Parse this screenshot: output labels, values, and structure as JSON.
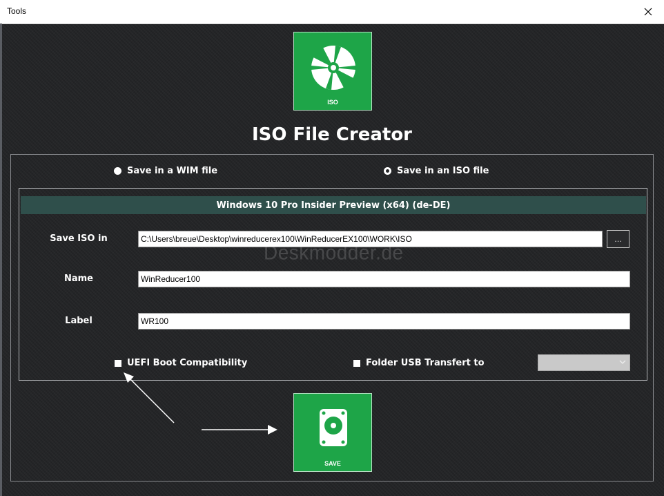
{
  "window": {
    "title": "Tools"
  },
  "iso_tile": {
    "label": "ISO",
    "icon": "disc-icon"
  },
  "heading": "ISO File Creator",
  "options": {
    "wim_label": "Save in a WIM file",
    "iso_label": "Save in an ISO file",
    "selected": "iso"
  },
  "edition": "Windows 10 Pro Insider Preview (x64) (de-DE)",
  "fields": {
    "save_iso_in": {
      "label": "Save ISO in",
      "value": "C:\\Users\\breue\\Desktop\\winreducerex100\\WinReducerEX100\\WORK\\ISO"
    },
    "name": {
      "label": "Name",
      "value": "WinReducer100"
    },
    "iso_label": {
      "label": "Label",
      "value": "WR100"
    }
  },
  "browse_label": "...",
  "checkboxes": {
    "uefi_label": "UEFI Boot Compatibility",
    "usb_label": "Folder USB Transfert to"
  },
  "save_tile": {
    "label": "SAVE",
    "icon": "hard-drive-icon"
  },
  "watermark": "Deskmodder.de",
  "colors": {
    "accent_green": "#1ea548",
    "edition_bar": "#2f4f4b"
  }
}
